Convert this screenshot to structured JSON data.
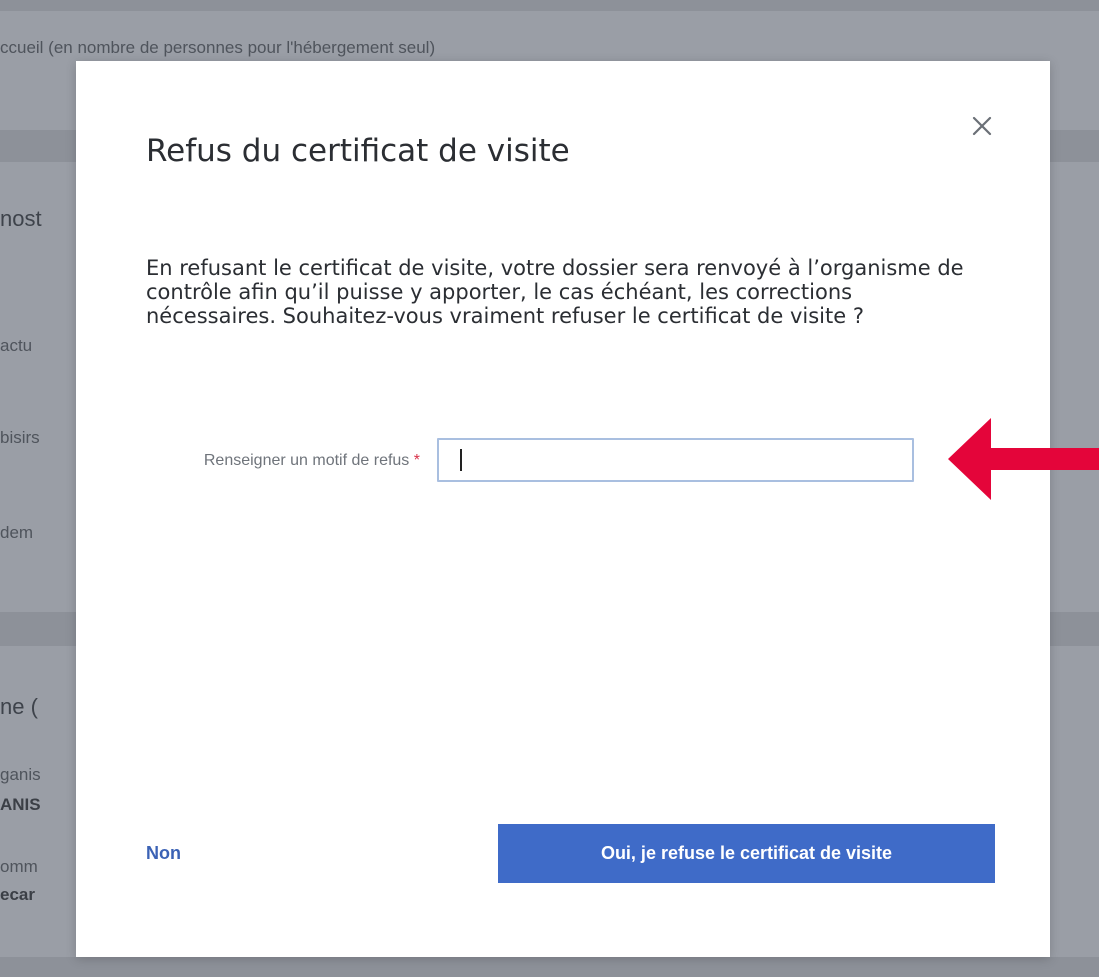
{
  "background": {
    "top_text": "ccueil (en nombre de personnes pour l'hébergement seul)",
    "fragments": [
      "nost",
      "actu",
      "bisirs",
      "dem",
      "ne (",
      "ganis",
      "ANIS",
      "omm",
      "ecar"
    ]
  },
  "modal": {
    "title": "Refus du certificat de visite",
    "body": "En refusant le certificat de visite, votre dossier sera renvoyé à l’organisme de contrôle afin qu’il puisse y apporter, le cas échéant, les corrections nécessaires. Souhaitez-vous vraiment refuser le certificat de visite ?",
    "field": {
      "label": "Renseigner un motif de refus",
      "required_marker": "*",
      "value": "",
      "placeholder": ""
    },
    "buttons": {
      "cancel_label": "Non",
      "confirm_label": "Oui, je refuse le certificat de visite"
    },
    "close_icon": "close-icon"
  },
  "annotation": {
    "icon": "arrow-left-icon",
    "color": "#e4053a"
  },
  "colors": {
    "overlay": "#9a9ea6",
    "primary": "#3f6bc8",
    "link": "#3b62b5",
    "required": "#d8324a",
    "input_border": "#a9bfe0"
  }
}
